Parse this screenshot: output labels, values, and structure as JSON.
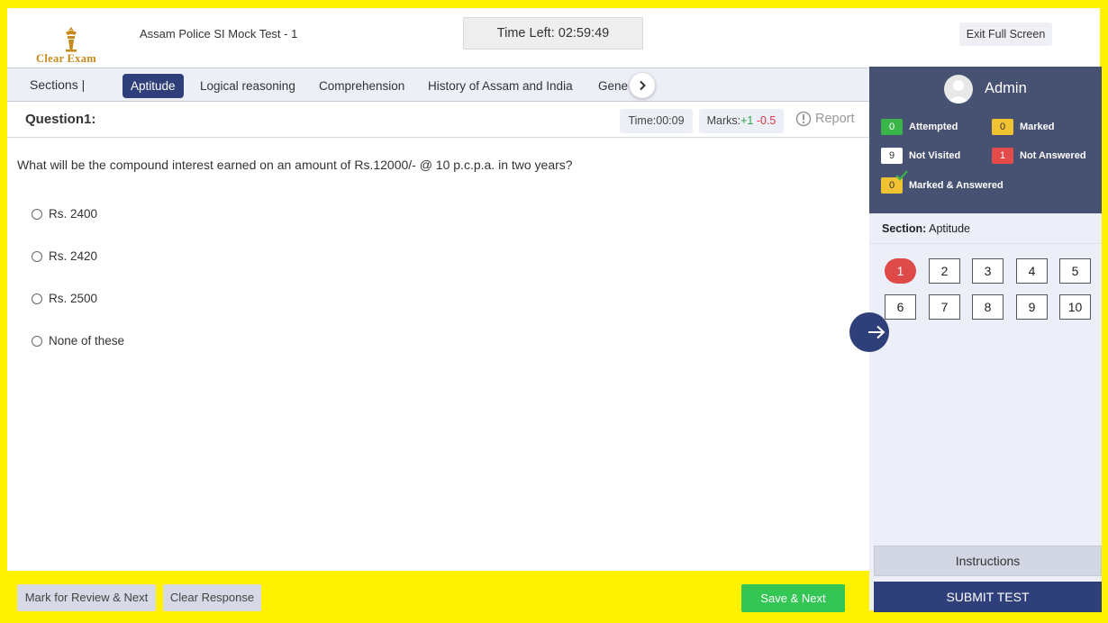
{
  "header": {
    "logo_text": "Clear Exam",
    "test_title": "Assam Police SI Mock Test - 1",
    "timer": "Time Left: 02:59:49",
    "exit_label": "Exit Full Screen"
  },
  "sections": {
    "label": "Sections |",
    "tabs": [
      "Aptitude",
      "Logical reasoning",
      "Comprehension",
      "History of Assam and India",
      "General"
    ],
    "active_index": 0
  },
  "question": {
    "title": "Question1:",
    "time": "Time:00:09",
    "marks_prefix": "Marks:",
    "marks_positive": "+1",
    "marks_negative": "-0.5",
    "report_label": "Report",
    "text": "What will be the compound interest earned on an amount of Rs.12000/- @ 10 p.c.p.a. in two years?",
    "options": [
      "Rs. 2400",
      "Rs. 2420",
      "Rs. 2500",
      "None of these"
    ]
  },
  "status": {
    "user": "Admin",
    "legend": [
      {
        "count": "0",
        "label": "Attempted",
        "color": "#3bb54a"
      },
      {
        "count": "0",
        "label": "Marked",
        "color": "#f1c232"
      },
      {
        "count": "9",
        "label": "Not Visited",
        "color": "#ffffff"
      },
      {
        "count": "1",
        "label": "Not Answered",
        "color": "#e34a4a"
      },
      {
        "count": "0",
        "label": "Marked & Answered",
        "color": "#f1c232"
      }
    ]
  },
  "palette": {
    "section_prefix": "Section:",
    "section_name": "Aptitude",
    "questions": [
      "1",
      "2",
      "3",
      "4",
      "5",
      "6",
      "7",
      "8",
      "9",
      "10"
    ],
    "current": "1"
  },
  "actions": {
    "instructions": "Instructions",
    "submit": "SUBMIT TEST",
    "mark_review": "Mark for Review & Next",
    "clear_response": "Clear Response",
    "save_next": "Save & Next"
  },
  "colors": {
    "frame": "#fff200",
    "primary": "#2f3f7a",
    "status_panel": "#475172",
    "current_question": "#dd4a48",
    "save_button": "#34c655"
  }
}
